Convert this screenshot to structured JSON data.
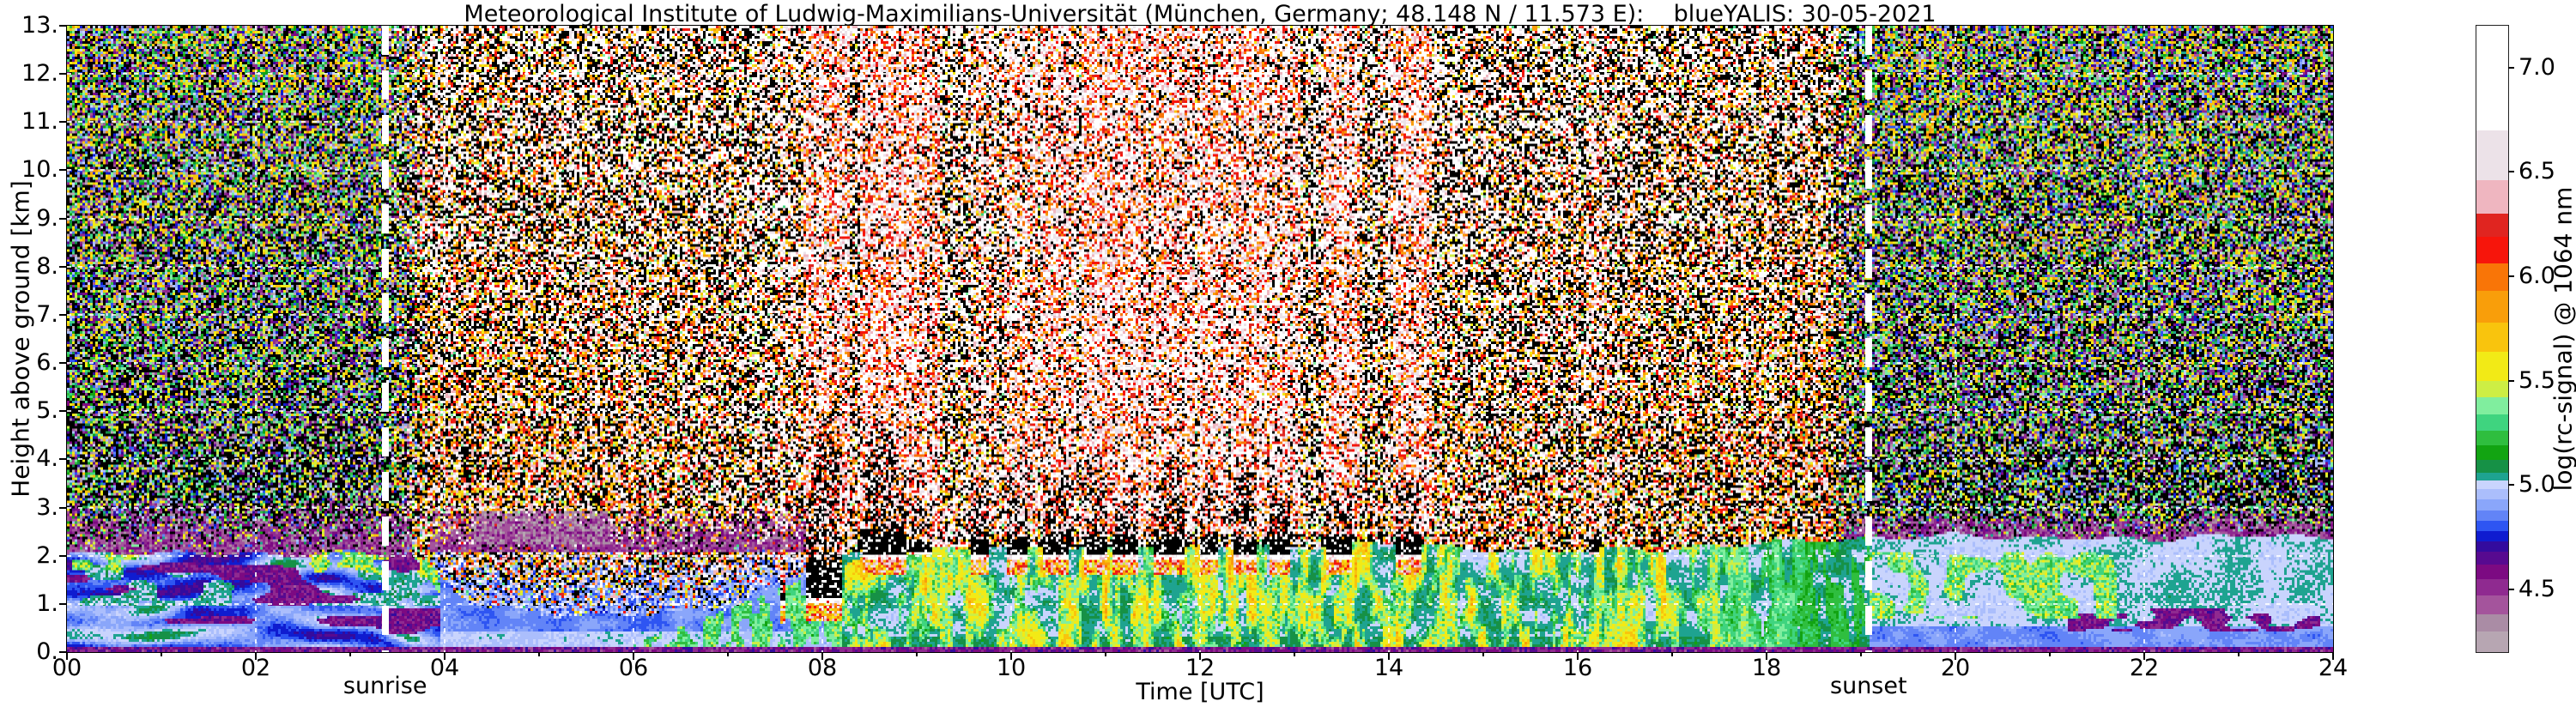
{
  "chart_data": {
    "type": "heatmap",
    "title": "Meteorological Institute of Ludwig-Maximilians-Universität (München, Germany; 48.148 N / 11.573 E):    blueYALIS: 30-05-2021",
    "station": "Meteorological Institute of Ludwig-Maximilians-Universität",
    "location": "München, Germany; 48.148 N / 11.573 E",
    "instrument": "blueYALIS",
    "date": "30-05-2021",
    "xlabel": "Time [UTC]",
    "ylabel": "Height above ground [km]",
    "x_range_hours": [
      0,
      24
    ],
    "y_range_km": [
      0,
      13
    ],
    "x_ticks": [
      "00",
      "02",
      "04",
      "06",
      "08",
      "10",
      "12",
      "14",
      "16",
      "18",
      "20",
      "22",
      "24"
    ],
    "y_ticks": [
      "0.",
      "1.",
      "2.",
      "3.",
      "4.",
      "5.",
      "6.",
      "7.",
      "8.",
      "9.",
      "10.",
      "11.",
      "12.",
      "13."
    ],
    "grid": {
      "x_interval_hours": 2,
      "y_interval_km": 1,
      "style": "white dashed",
      "on": true
    },
    "colorbar": {
      "label": "log(rc-signal) @ 1064 nm",
      "ticks": [
        "4.5",
        "5.0",
        "5.5",
        "6.0",
        "6.5",
        "7.0"
      ],
      "range": [
        4.2,
        7.2
      ],
      "under_color": "#000000",
      "over_color": "#ffffff",
      "stops": [
        [
          4.2,
          "#b7a6b2"
        ],
        [
          4.3,
          "#aa8ca5"
        ],
        [
          4.38,
          "#a4549c"
        ],
        [
          4.47,
          "#8f2a90"
        ],
        [
          4.55,
          "#7c0a82"
        ],
        [
          4.62,
          "#570a90"
        ],
        [
          4.68,
          "#330b9e"
        ],
        [
          4.73,
          "#0f1cd0"
        ],
        [
          4.78,
          "#2e55f2"
        ],
        [
          4.83,
          "#6284f7"
        ],
        [
          4.88,
          "#8aa6fa"
        ],
        [
          4.93,
          "#abbefc"
        ],
        [
          4.98,
          "#c9d4fd"
        ],
        [
          5.02,
          "#1ea390"
        ],
        [
          5.06,
          "#169146"
        ],
        [
          5.12,
          "#12a412"
        ],
        [
          5.19,
          "#2fbe3f"
        ],
        [
          5.26,
          "#3fd47f"
        ],
        [
          5.34,
          "#80ee9e"
        ],
        [
          5.42,
          "#cdee44"
        ],
        [
          5.5,
          "#f2ea16"
        ],
        [
          5.64,
          "#f9c40d"
        ],
        [
          5.78,
          "#f99e0a"
        ],
        [
          5.93,
          "#f97507"
        ],
        [
          6.06,
          "#f7150b"
        ],
        [
          6.19,
          "#e02520"
        ],
        [
          6.3,
          "#efb6c0"
        ],
        [
          6.46,
          "#ece2e8"
        ],
        [
          6.7,
          "#ffffff"
        ]
      ]
    },
    "annotations": {
      "sunrise": {
        "label": "sunrise",
        "time_utc": 3.37
      },
      "sunset": {
        "label": "sunset",
        "time_utc": 19.08
      }
    },
    "scene": {
      "description": "Lidar range-corrected signal quicklook: blue nocturnal/residual boundary layer below ~2 km, green convective plumes from ~06-19 UTC, cumulus cloud band (black/white, log-signal saturated) near 2 km between ~08 and ~14:30 UTC with white attenuation stripes above, magenta gradient layer just above the boundary layer at night, and background solar noise speckle aloft (green/dark at night, orange/red/white in daytime).",
      "boundary_layer_top": [
        [
          0,
          2.05
        ],
        [
          0.5,
          2.1
        ],
        [
          1,
          2.05
        ],
        [
          1.5,
          2.0
        ],
        [
          2,
          2.05
        ],
        [
          2.5,
          2.0
        ],
        [
          3,
          2.05
        ],
        [
          3.5,
          2.0
        ],
        [
          3.8,
          1.9
        ],
        [
          4.1,
          1.3
        ],
        [
          4.4,
          0.95
        ],
        [
          5,
          0.8
        ],
        [
          5.5,
          0.75
        ],
        [
          6,
          0.8
        ],
        [
          6.5,
          0.85
        ],
        [
          7,
          0.95
        ],
        [
          7.5,
          1.3
        ],
        [
          7.8,
          1.6
        ],
        [
          8.1,
          1.9
        ],
        [
          8.5,
          2.1
        ],
        [
          9,
          2.15
        ],
        [
          10,
          2.2
        ],
        [
          11,
          2.2
        ],
        [
          12,
          2.2
        ],
        [
          13,
          2.2
        ],
        [
          14,
          2.25
        ],
        [
          15,
          2.15
        ],
        [
          16,
          2.1
        ],
        [
          17,
          2.15
        ],
        [
          18,
          2.25
        ],
        [
          19,
          2.35
        ],
        [
          20,
          2.4
        ],
        [
          21,
          2.35
        ],
        [
          22,
          2.35
        ],
        [
          23,
          2.4
        ],
        [
          24,
          2.35
        ]
      ],
      "clouds": [
        {
          "t": [
            7.55,
            7.62
          ],
          "base": 0.95,
          "top": 1.2,
          "att": 0.3,
          "plume": 0.8
        },
        {
          "t": [
            7.83,
            8.2
          ],
          "base": 1.0,
          "top": 1.9,
          "att": 0.85,
          "plume": 2.4
        },
        {
          "t": [
            8.42,
            8.88
          ],
          "top": 2.5,
          "att": 1.0,
          "plume": 2.0
        },
        {
          "t": [
            8.93,
            9.15
          ],
          "base": 2.0,
          "top": 2.3,
          "att": 0.85,
          "thin": true,
          "plume": 0.6
        },
        {
          "t": [
            9.58,
            9.77
          ],
          "att": 0.5
        },
        {
          "t": [
            9.95,
            10.18
          ],
          "att": 0.7
        },
        {
          "t": [
            10.33,
            10.6
          ],
          "att": 0.8
        },
        {
          "t": [
            10.77,
            11.02
          ],
          "att": 1.0
        },
        {
          "t": [
            11.08,
            11.35
          ],
          "att": 1.0
        },
        {
          "t": [
            11.5,
            11.85
          ],
          "att": 0.9
        },
        {
          "t": [
            12.0,
            12.2
          ],
          "att": 0.9
        },
        {
          "t": [
            12.35,
            12.6
          ],
          "att": 0.9
        },
        {
          "t": [
            12.75,
            12.95
          ],
          "att": 0.7
        },
        {
          "t": [
            13.33,
            13.6
          ],
          "att": 0.9
        },
        {
          "t": [
            14.08,
            14.35
          ],
          "att": 0.9
        },
        {
          "t": [
            16.13,
            16.22
          ],
          "base": 2.0,
          "top": 2.3,
          "att": 0.35,
          "thin": true,
          "plume": 0.4
        }
      ]
    }
  }
}
